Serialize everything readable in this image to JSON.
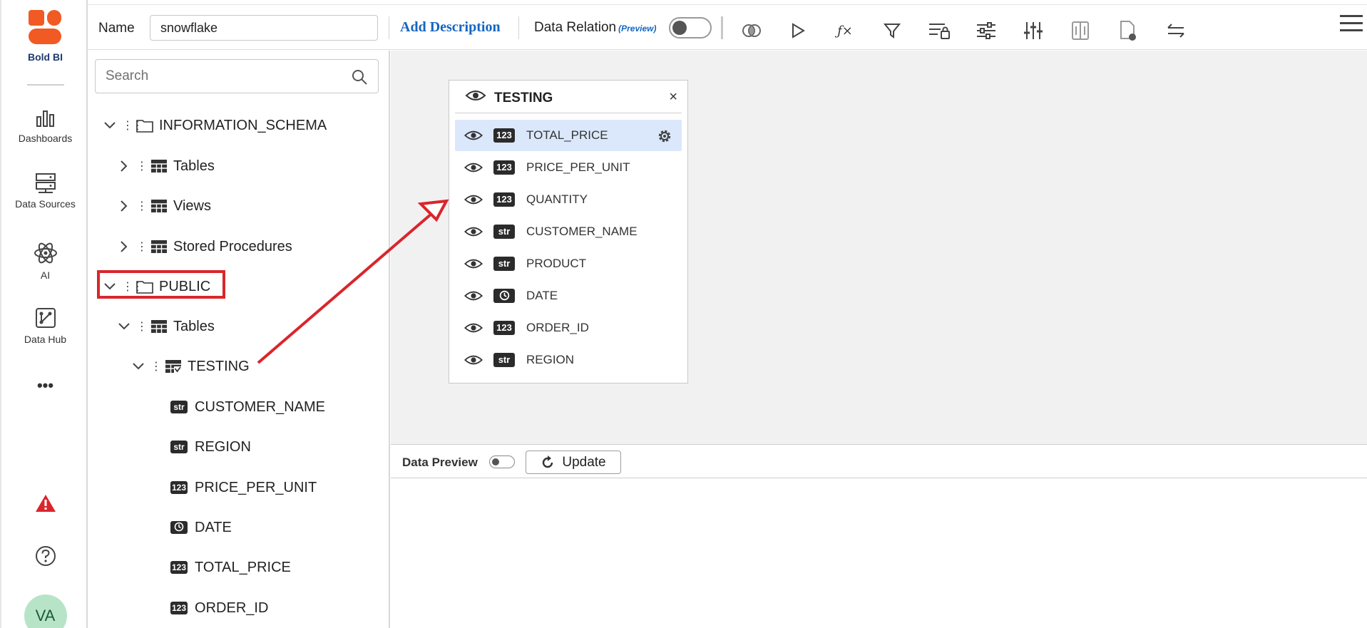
{
  "brand": {
    "name": "Bold BI",
    "color": "#f15a22"
  },
  "nav": {
    "items": [
      {
        "label": "Dashboards",
        "icon": "bar-chart-icon"
      },
      {
        "label": "Data Sources",
        "icon": "server-icon"
      },
      {
        "label": "AI",
        "icon": "atom-icon"
      },
      {
        "label": "Data Hub",
        "icon": "data-hub-icon"
      }
    ],
    "more": "•••",
    "avatar": "VA"
  },
  "toolbar": {
    "name_label": "Name",
    "name_value": "snowflake",
    "add_description": "Add Description",
    "data_relation": "Data Relation",
    "preview_tag": "(Preview)",
    "icons": [
      "join-icon",
      "run-icon",
      "expression-icon",
      "filter-icon",
      "row-security-icon",
      "settings-sliders-icon",
      "column-sliders-icon",
      "split-icon",
      "file-icon",
      "swap-icon"
    ]
  },
  "schema": {
    "search_placeholder": "Search",
    "nodes": {
      "info_schema": "INFORMATION_SCHEMA",
      "tables": "Tables",
      "views": "Views",
      "stored_procedures": "Stored Procedures",
      "public": "PUBLIC",
      "public_tables": "Tables",
      "testing": "TESTING"
    },
    "columns": [
      {
        "type": "str",
        "name": "CUSTOMER_NAME"
      },
      {
        "type": "str",
        "name": "REGION"
      },
      {
        "type": "123",
        "name": "PRICE_PER_UNIT"
      },
      {
        "type": "date",
        "name": "DATE"
      },
      {
        "type": "123",
        "name": "TOTAL_PRICE"
      },
      {
        "type": "123",
        "name": "ORDER_ID"
      }
    ]
  },
  "table_card": {
    "title": "TESTING",
    "close": "×",
    "rows": [
      {
        "type": "123",
        "name": "TOTAL_PRICE",
        "selected": true
      },
      {
        "type": "123",
        "name": "PRICE_PER_UNIT"
      },
      {
        "type": "123",
        "name": "QUANTITY"
      },
      {
        "type": "str",
        "name": "CUSTOMER_NAME"
      },
      {
        "type": "str",
        "name": "PRODUCT"
      },
      {
        "type": "date",
        "name": "DATE"
      },
      {
        "type": "123",
        "name": "ORDER_ID"
      },
      {
        "type": "str",
        "name": "REGION"
      }
    ]
  },
  "preview": {
    "label": "Data Preview",
    "update": "Update"
  },
  "colors": {
    "accent": "#1565c0",
    "annotation": "#d9262c",
    "selected_row": "#dbe8fb"
  }
}
